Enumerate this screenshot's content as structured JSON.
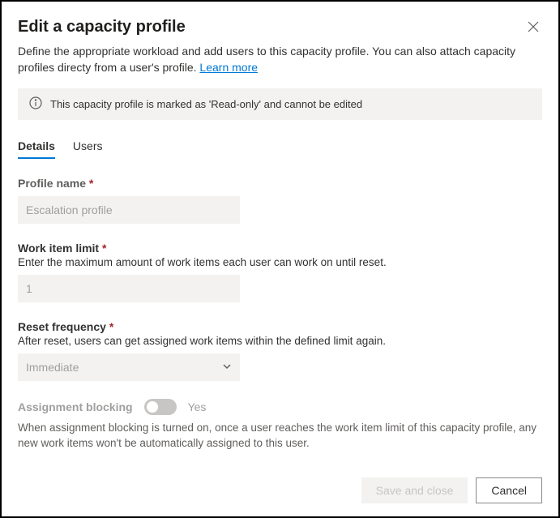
{
  "header": {
    "title": "Edit a capacity profile",
    "description_1": "Define the appropriate workload and add users to this capacity profile. You can also attach capacity profiles directy from a user's profile. ",
    "learn_more": "Learn more"
  },
  "banner": {
    "text": "This capacity profile is marked as 'Read-only' and cannot be edited"
  },
  "tabs": {
    "details": "Details",
    "users": "Users"
  },
  "fields": {
    "profile_name": {
      "label": "Profile name",
      "value": "Escalation profile"
    },
    "work_item_limit": {
      "label": "Work item limit",
      "help": "Enter the maximum amount of work items each user can work on until reset.",
      "value": "1"
    },
    "reset_frequency": {
      "label": "Reset frequency",
      "help": "After reset, users can get assigned work items within the defined limit again.",
      "value": "Immediate"
    },
    "assignment_blocking": {
      "label": "Assignment blocking",
      "value": "Yes",
      "help": "When assignment blocking is turned on, once a user reaches the work item limit of this capacity profile, any new work items won't be automatically assigned to this user."
    }
  },
  "footer": {
    "save": "Save and close",
    "cancel": "Cancel"
  }
}
